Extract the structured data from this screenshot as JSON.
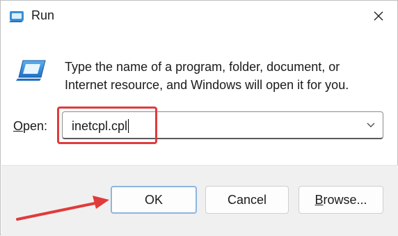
{
  "window": {
    "title": "Run",
    "close_icon": "close-icon",
    "app_icon": "run-icon"
  },
  "content": {
    "description_line1": "Type the name of a program, folder, document, or",
    "description_line2": "Internet resource, and Windows will open it for you.",
    "open_label_accel": "O",
    "open_label_rest": "pen:",
    "open_value": "inetcpl.cpl"
  },
  "buttons": {
    "ok": "OK",
    "cancel": "Cancel",
    "browse_accel": "B",
    "browse_rest": "rowse..."
  },
  "colors": {
    "annotation": "#e03b3b",
    "ok_border": "#8cb6e0",
    "footer_bg": "#f0f0f0"
  },
  "icons": {
    "combo_dropdown": "chevron-down-icon",
    "run_icon": "run-icon"
  }
}
